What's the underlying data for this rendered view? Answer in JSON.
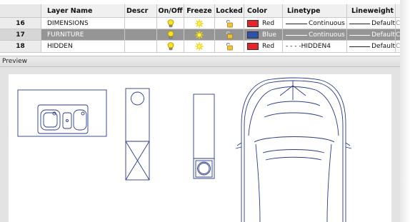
{
  "grid": {
    "headers": {
      "num": "",
      "name": "Layer Name",
      "desc": "Descr",
      "onoff": "On/Off",
      "freeze": "Freeze",
      "locked": "Locked",
      "color": "Color",
      "linetype": "Linetype",
      "lineweight": "Lineweight"
    },
    "rows": [
      {
        "num": "16",
        "name": "DIMENSIONS",
        "color_name": "Red",
        "color_hex": "#e8232a",
        "linetype": "Continuous",
        "lineweight": "Default",
        "selected": false
      },
      {
        "num": "17",
        "name": "FURNITURE",
        "color_name": "Blue",
        "color_hex": "#3050b0",
        "linetype": "Continuous",
        "lineweight": "Default",
        "selected": true
      },
      {
        "num": "18",
        "name": "HIDDEN",
        "color_name": "Red",
        "color_hex": "#e8232a",
        "linetype": "- - - -HIDDEN4",
        "lineweight": "Default",
        "selected": false
      }
    ],
    "icons": {
      "on": "lightbulb-on-icon",
      "freeze": "sun-thawed-icon",
      "locked": "padlock-icon"
    },
    "overflow_col": "C"
  },
  "preview": {
    "label": "Preview",
    "stroke_color": "#2a3a8c"
  }
}
